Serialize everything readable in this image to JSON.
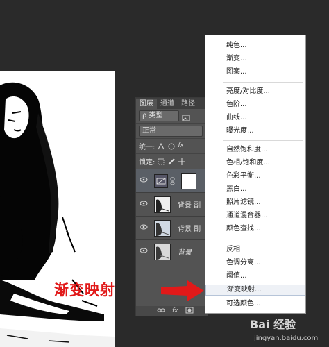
{
  "layers_panel": {
    "tabs": [
      "图层",
      "通道",
      "路径"
    ],
    "filter_kind": "ρ 类型",
    "blend_mode": "正常",
    "unify_label": "统一:",
    "lock_label": "锁定:",
    "layers": [
      {
        "label": "",
        "type": "adjustment",
        "selected": true
      },
      {
        "label": "背景 副",
        "type": "photo",
        "selected": false
      },
      {
        "label": "背景 副",
        "type": "photo",
        "selected": false
      },
      {
        "label": "背景",
        "type": "photo",
        "italic": true,
        "selected": false
      }
    ],
    "footer_icons": [
      "link-icon",
      "fx",
      "mask-icon"
    ]
  },
  "adjustment_menu": {
    "groups": [
      [
        "纯色...",
        "渐变...",
        "图案..."
      ],
      [
        "亮度/对比度...",
        "色阶...",
        "曲线...",
        "曝光度..."
      ],
      [
        "自然饱和度...",
        "色相/饱和度...",
        "色彩平衡...",
        "黑白...",
        "照片滤镜...",
        "通道混合器...",
        "颜色查找..."
      ],
      [
        "反相",
        "色调分离...",
        "阈值...",
        "渐变映射...",
        "可选颜色..."
      ]
    ],
    "highlighted": "渐变映射..."
  },
  "annotation": {
    "text": "渐变映射",
    "color": "#e11919"
  },
  "watermark": {
    "brand": "Bai 经验",
    "url": "jingyan.baidu.com"
  }
}
